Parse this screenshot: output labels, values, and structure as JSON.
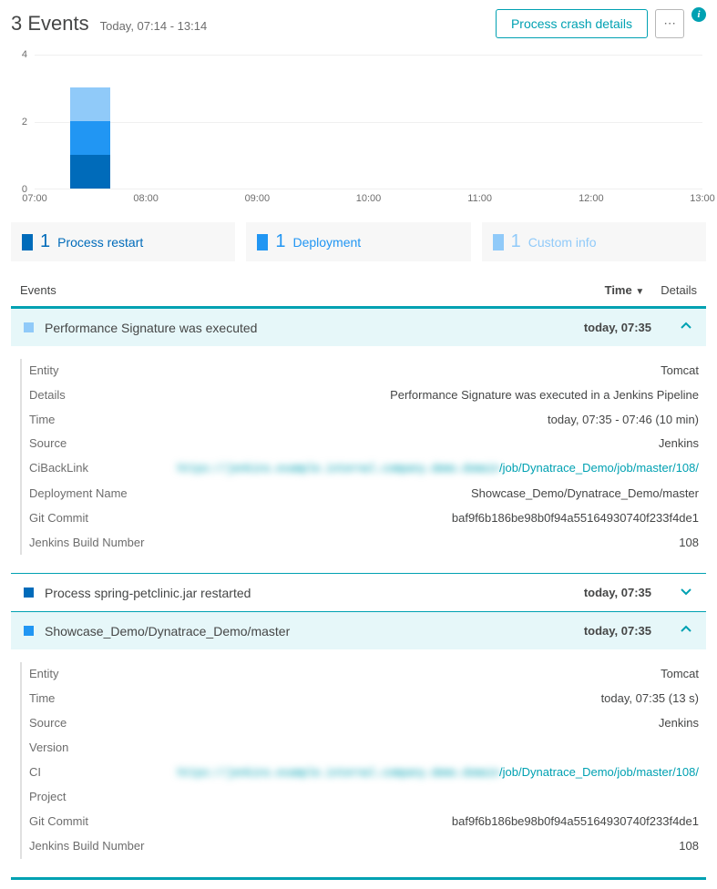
{
  "header": {
    "title": "3 Events",
    "subtitle": "Today, 07:14 - 13:14",
    "crash_btn": "Process crash details"
  },
  "chart_data": {
    "type": "bar",
    "stacked": true,
    "categories": [
      "07:00",
      "08:00",
      "09:00",
      "10:00",
      "11:00",
      "12:00",
      "13:00"
    ],
    "series": [
      {
        "name": "Process restart",
        "color": "#006bba",
        "values": [
          1,
          0,
          0,
          0,
          0,
          0,
          0
        ]
      },
      {
        "name": "Deployment",
        "color": "#2196f3",
        "values": [
          1,
          0,
          0,
          0,
          0,
          0,
          0
        ]
      },
      {
        "name": "Custom info",
        "color": "#90caf9",
        "values": [
          1,
          0,
          0,
          0,
          0,
          0,
          0
        ]
      }
    ],
    "ylim": [
      0,
      4
    ],
    "y_ticks": [
      0,
      2,
      4
    ],
    "xlabel": "",
    "ylabel": "",
    "title": ""
  },
  "legend": [
    {
      "count": "1",
      "label": "Process restart"
    },
    {
      "count": "1",
      "label": "Deployment"
    },
    {
      "count": "1",
      "label": "Custom info"
    }
  ],
  "table": {
    "col_events": "Events",
    "col_time": "Time",
    "col_details": "Details"
  },
  "events": [
    {
      "icon": "c3",
      "title": "Performance Signature was executed",
      "time": "today, 07:35",
      "expanded": true,
      "rows": [
        {
          "label": "Entity",
          "value": "Tomcat"
        },
        {
          "label": "Details",
          "value": "Performance Signature was executed in a Jenkins Pipeline"
        },
        {
          "label": "Time",
          "value": "today, 07:35 - 07:46 (10 min)"
        },
        {
          "label": "Source",
          "value": "Jenkins"
        },
        {
          "label": "CiBackLink",
          "value": "/job/Dynatrace_Demo/job/master/108/",
          "obscured": true,
          "link": true
        },
        {
          "label": "Deployment Name",
          "value": "Showcase_Demo/Dynatrace_Demo/master"
        },
        {
          "label": "Git Commit",
          "value": "baf9f6b186be98b0f94a55164930740f233f4de1"
        },
        {
          "label": "Jenkins Build Number",
          "value": "108"
        }
      ]
    },
    {
      "icon": "c1",
      "title": "Process spring-petclinic.jar restarted",
      "time": "today, 07:35",
      "expanded": false
    },
    {
      "icon": "c2",
      "title": "Showcase_Demo/Dynatrace_Demo/master",
      "time": "today, 07:35",
      "expanded": true,
      "rows": [
        {
          "label": "Entity",
          "value": "Tomcat"
        },
        {
          "label": "Time",
          "value": "today, 07:35 (13 s)"
        },
        {
          "label": "Source",
          "value": "Jenkins"
        },
        {
          "label": "Version",
          "value": ""
        },
        {
          "label": "CI",
          "value": "/job/Dynatrace_Demo/job/master/108/",
          "obscured": true,
          "link": true
        },
        {
          "label": "Project",
          "value": ""
        },
        {
          "label": "Git Commit",
          "value": "baf9f6b186be98b0f94a55164930740f233f4de1"
        },
        {
          "label": "Jenkins Build Number",
          "value": "108"
        }
      ]
    }
  ]
}
